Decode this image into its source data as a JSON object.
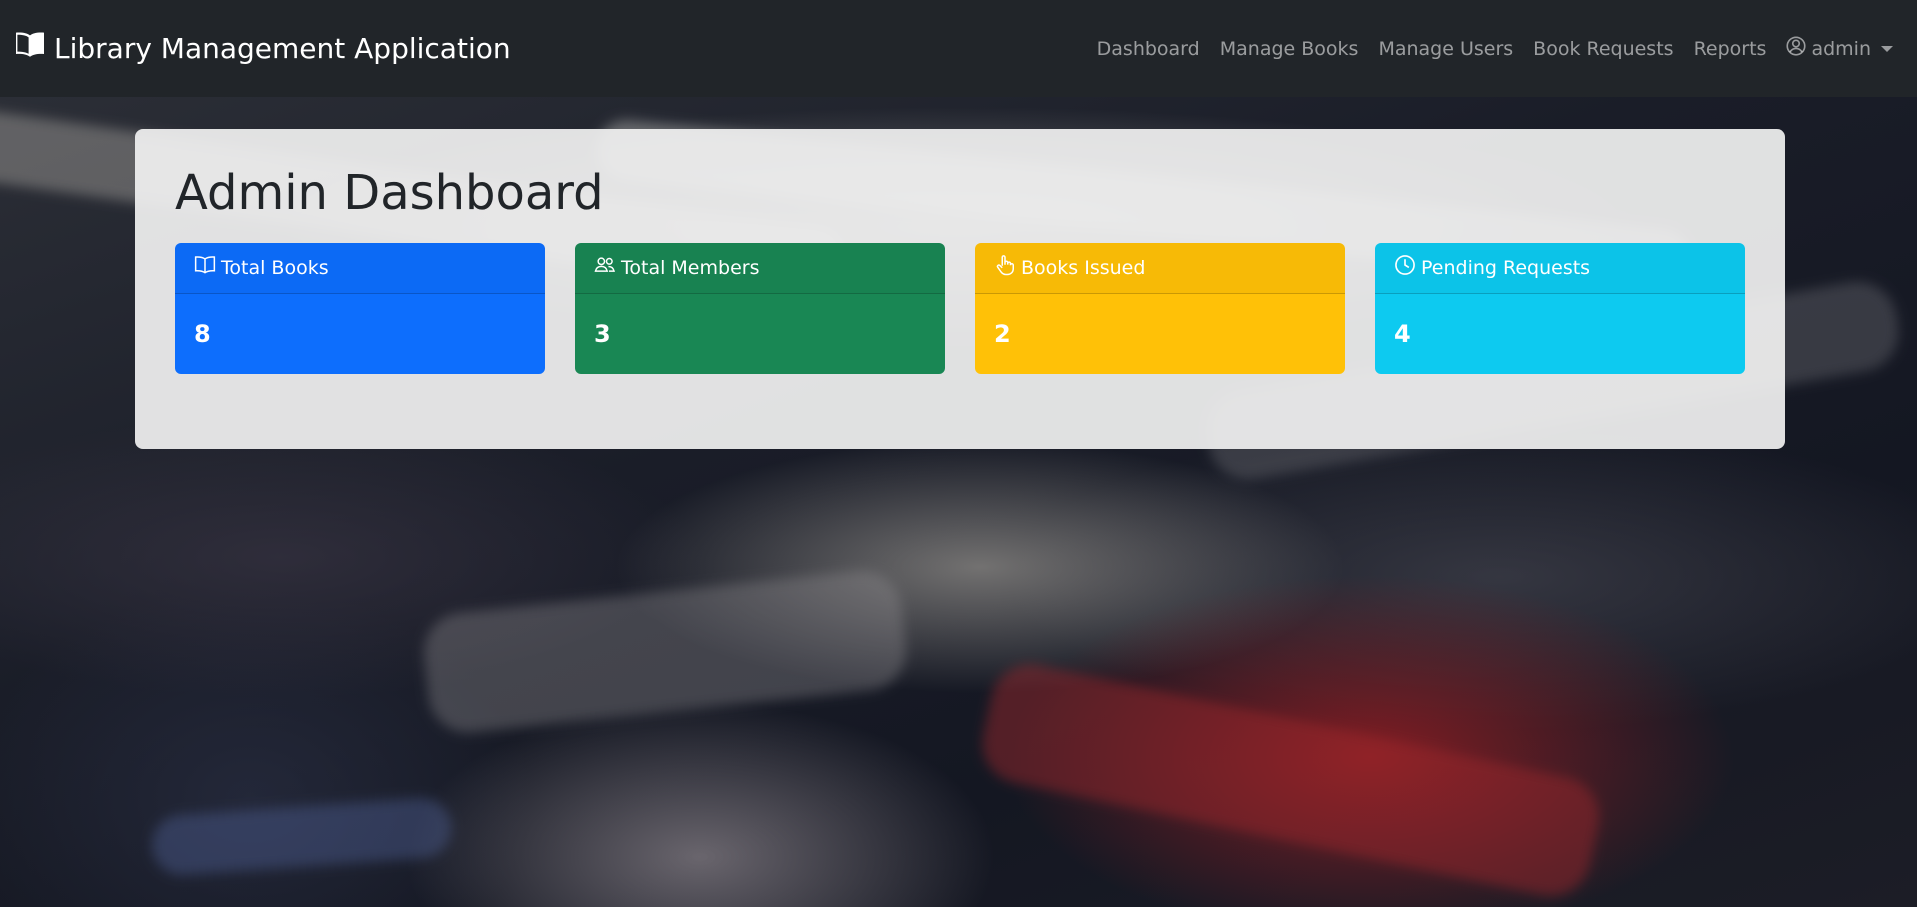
{
  "app": {
    "brand": "Library Management Application",
    "brand_icon": "book-icon"
  },
  "nav": {
    "items": [
      {
        "label": "Dashboard"
      },
      {
        "label": "Manage Books"
      },
      {
        "label": "Manage Users"
      },
      {
        "label": "Book Requests"
      },
      {
        "label": "Reports"
      }
    ],
    "user": {
      "label": "admin",
      "icon": "user-circle-icon"
    }
  },
  "main": {
    "title": "Admin Dashboard",
    "cards": [
      {
        "label": "Total Books",
        "value": "8",
        "icon": "book-icon",
        "color": "#0d6efd"
      },
      {
        "label": "Total Members",
        "value": "3",
        "icon": "people-icon",
        "color": "#198754"
      },
      {
        "label": "Books Issued",
        "value": "2",
        "icon": "hand-pointer-icon",
        "color": "#ffc107"
      },
      {
        "label": "Pending Requests",
        "value": "4",
        "icon": "clock-icon",
        "color": "#0dcaf0"
      }
    ]
  },
  "colors": {
    "navbar": "#212529",
    "primary": "#0d6efd",
    "success": "#198754",
    "warning": "#ffc107",
    "info": "#0dcaf0"
  }
}
